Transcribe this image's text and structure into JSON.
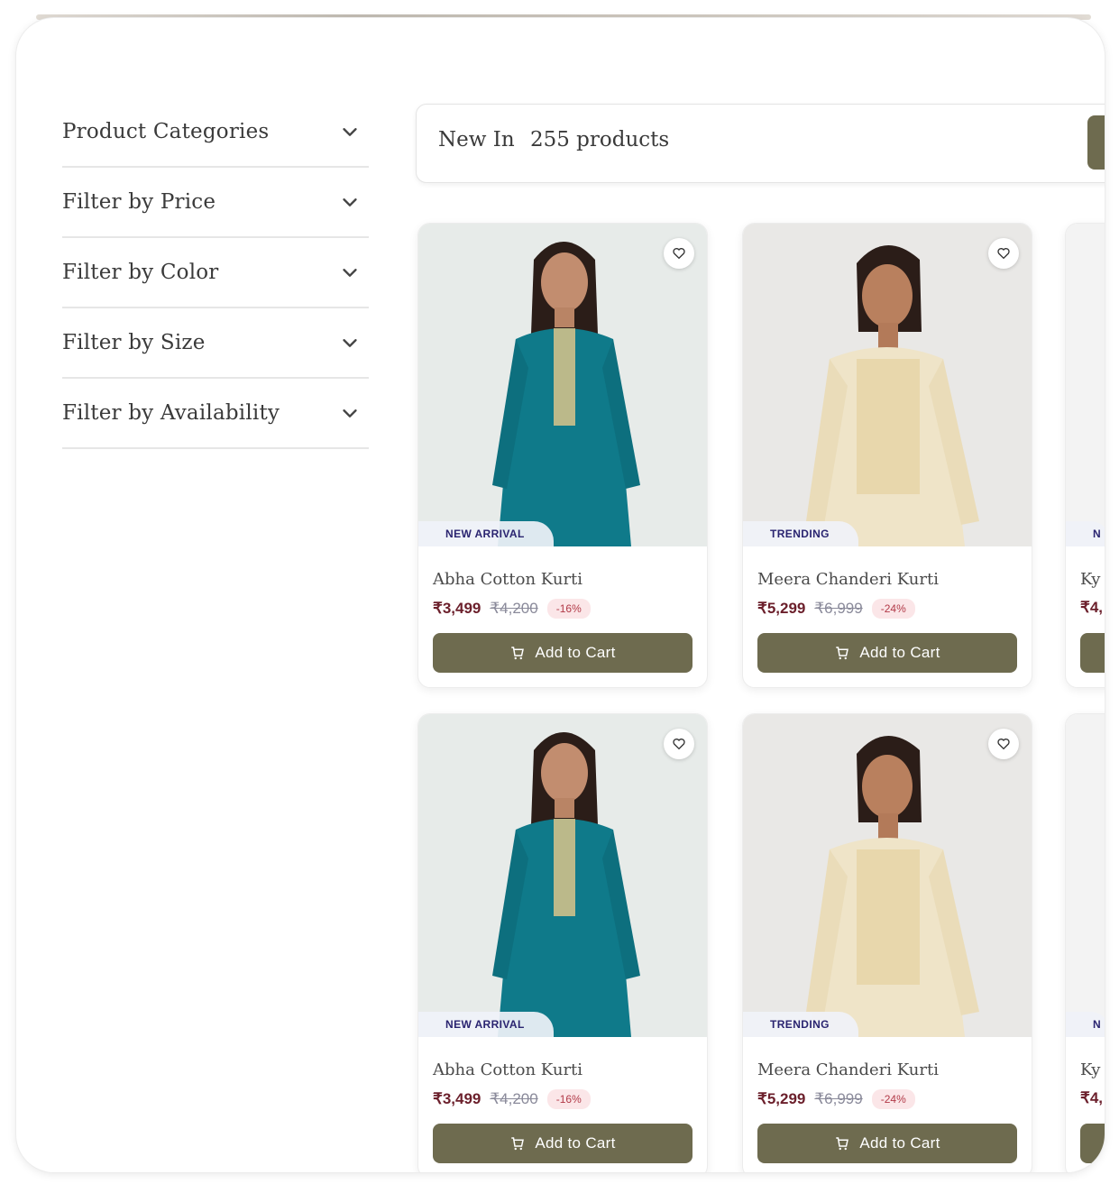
{
  "filters": [
    {
      "label": "Product Categories"
    },
    {
      "label": "Filter by Price"
    },
    {
      "label": "Filter by Color"
    },
    {
      "label": "Filter by Size"
    },
    {
      "label": "Filter by Availability"
    }
  ],
  "header": {
    "title": "New In",
    "count": "255 products"
  },
  "products": [
    {
      "name": "Abha Cotton Kurti",
      "price": "₹3,499",
      "mrp": "₹4,200",
      "discount": "-16%",
      "badge": "NEW ARRIVAL",
      "cart": "Add to Cart",
      "garment_color": "#0f7a8a"
    },
    {
      "name": "Meera Chanderi Kurti",
      "price": "₹5,299",
      "mrp": "₹6,999",
      "discount": "-24%",
      "badge": "TRENDING",
      "cart": "Add to Cart",
      "garment_color": "#efe4c8"
    },
    {
      "name": "Ky",
      "price": "₹4,",
      "mrp": "",
      "discount": "",
      "badge": "N",
      "cart": "",
      "garment_color": "#f3f3f3"
    },
    {
      "name": "Abha Cotton Kurti",
      "price": "₹3,499",
      "mrp": "₹4,200",
      "discount": "-16%",
      "badge": "NEW ARRIVAL",
      "cart": "Add to Cart",
      "garment_color": "#0f7a8a"
    },
    {
      "name": "Meera Chanderi Kurti",
      "price": "₹5,299",
      "mrp": "₹6,999",
      "discount": "-24%",
      "badge": "TRENDING",
      "cart": "Add to Cart",
      "garment_color": "#efe4c8"
    },
    {
      "name": "Ky",
      "price": "₹4,",
      "mrp": "",
      "discount": "",
      "badge": "N",
      "cart": "",
      "garment_color": "#f3f3f3"
    }
  ],
  "colors": {
    "accent": "#6e6b4f",
    "price": "#6b1f2b",
    "badge_text": "#2a2470"
  }
}
